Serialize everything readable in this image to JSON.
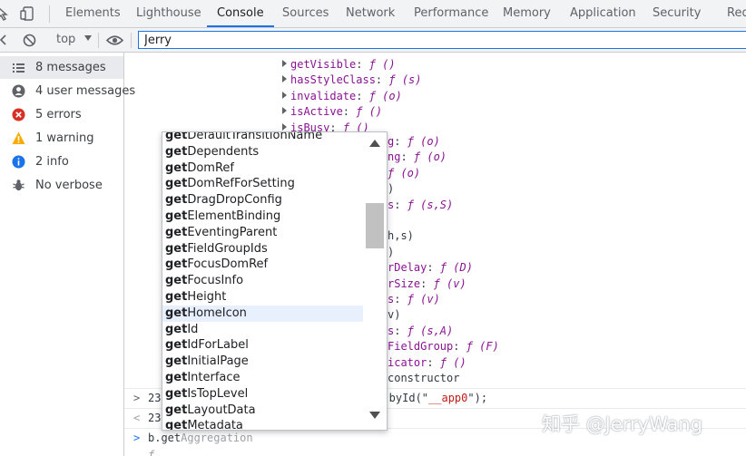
{
  "tabs": [
    "Elements",
    "Lighthouse",
    "Console",
    "Sources",
    "Network",
    "Performance",
    "Memory",
    "Application",
    "Security",
    "Red"
  ],
  "active_tab": "Console",
  "toolbar": {
    "context": "top",
    "filter_value": "Jerry"
  },
  "sidebar": {
    "items": [
      {
        "label": "8 messages",
        "icon": "list-icon",
        "selected": true
      },
      {
        "label": "4 user messages",
        "icon": "user-icon",
        "selected": false
      },
      {
        "label": "5 errors",
        "icon": "error-icon",
        "selected": false
      },
      {
        "label": "1 warning",
        "icon": "warning-icon",
        "selected": false
      },
      {
        "label": "2 info",
        "icon": "info-icon",
        "selected": false
      },
      {
        "label": "No verbose",
        "icon": "bug-icon",
        "selected": false
      }
    ]
  },
  "colors": {
    "accent": "#1a73e8",
    "error": "#d93025",
    "warning": "#f9ab00",
    "info": "#1a73e8",
    "property": "#881391",
    "string": "#c41a16"
  },
  "properties": [
    {
      "key": "getVisible",
      "val": "ƒ ()"
    },
    {
      "key": "hasStyleClass",
      "val": "ƒ (s)"
    },
    {
      "key": "invalidate",
      "val": "ƒ (o)"
    },
    {
      "key": "isActive",
      "val": "ƒ ()"
    },
    {
      "key": "isBusy",
      "val": "ƒ ()"
    }
  ],
  "partial_lines": [
    {
      "key": "g",
      "val": "ƒ (o)"
    },
    {
      "key": "ng",
      "val": "ƒ (o)"
    },
    {
      "key": "",
      "val": "ƒ (o)"
    },
    {
      "key": "",
      "val": ")"
    },
    {
      "key": "s",
      "val": "ƒ (s,S)"
    },
    {
      "key": "",
      "val": ""
    },
    {
      "key": "",
      "val": "h,s)"
    },
    {
      "key": "",
      "val": ")"
    },
    {
      "key": "rDelay",
      "val": "ƒ (D)"
    },
    {
      "key": "rSize",
      "val": "ƒ (v)"
    },
    {
      "key": "s",
      "val": "ƒ (v)"
    },
    {
      "key": "",
      "val": "v)"
    },
    {
      "key": "s",
      "val": "ƒ (s,A)"
    },
    {
      "key": "FieldGroup",
      "val": "ƒ (F)"
    },
    {
      "key": "icator",
      "val": "ƒ ()"
    },
    {
      "key": "",
      "val": "constructor"
    }
  ],
  "output_rows": [
    {
      "prefix": "23",
      "tail": ".byId(\"",
      "str": "__app0",
      "end": "\");"
    },
    {
      "prefix": "23",
      "tail": "",
      "str": "",
      "end": ""
    }
  ],
  "input_line": {
    "typed": "b.get",
    "ghost": "Aggregation",
    "next": "f"
  },
  "autocomplete": {
    "prefix": "get",
    "items": [
      "DefaultTransitionName",
      "Dependents",
      "DomRef",
      "DomRefForSetting",
      "DragDropConfig",
      "ElementBinding",
      "EventingParent",
      "FieldGroupIds",
      "FocusDomRef",
      "FocusInfo",
      "Height",
      "HomeIcon",
      "Id",
      "IdForLabel",
      "InitialPage",
      "Interface",
      "IsTopLevel",
      "LayoutData",
      "Metadata"
    ],
    "highlighted": "HomeIcon"
  },
  "watermark": "知乎 @JerryWang"
}
